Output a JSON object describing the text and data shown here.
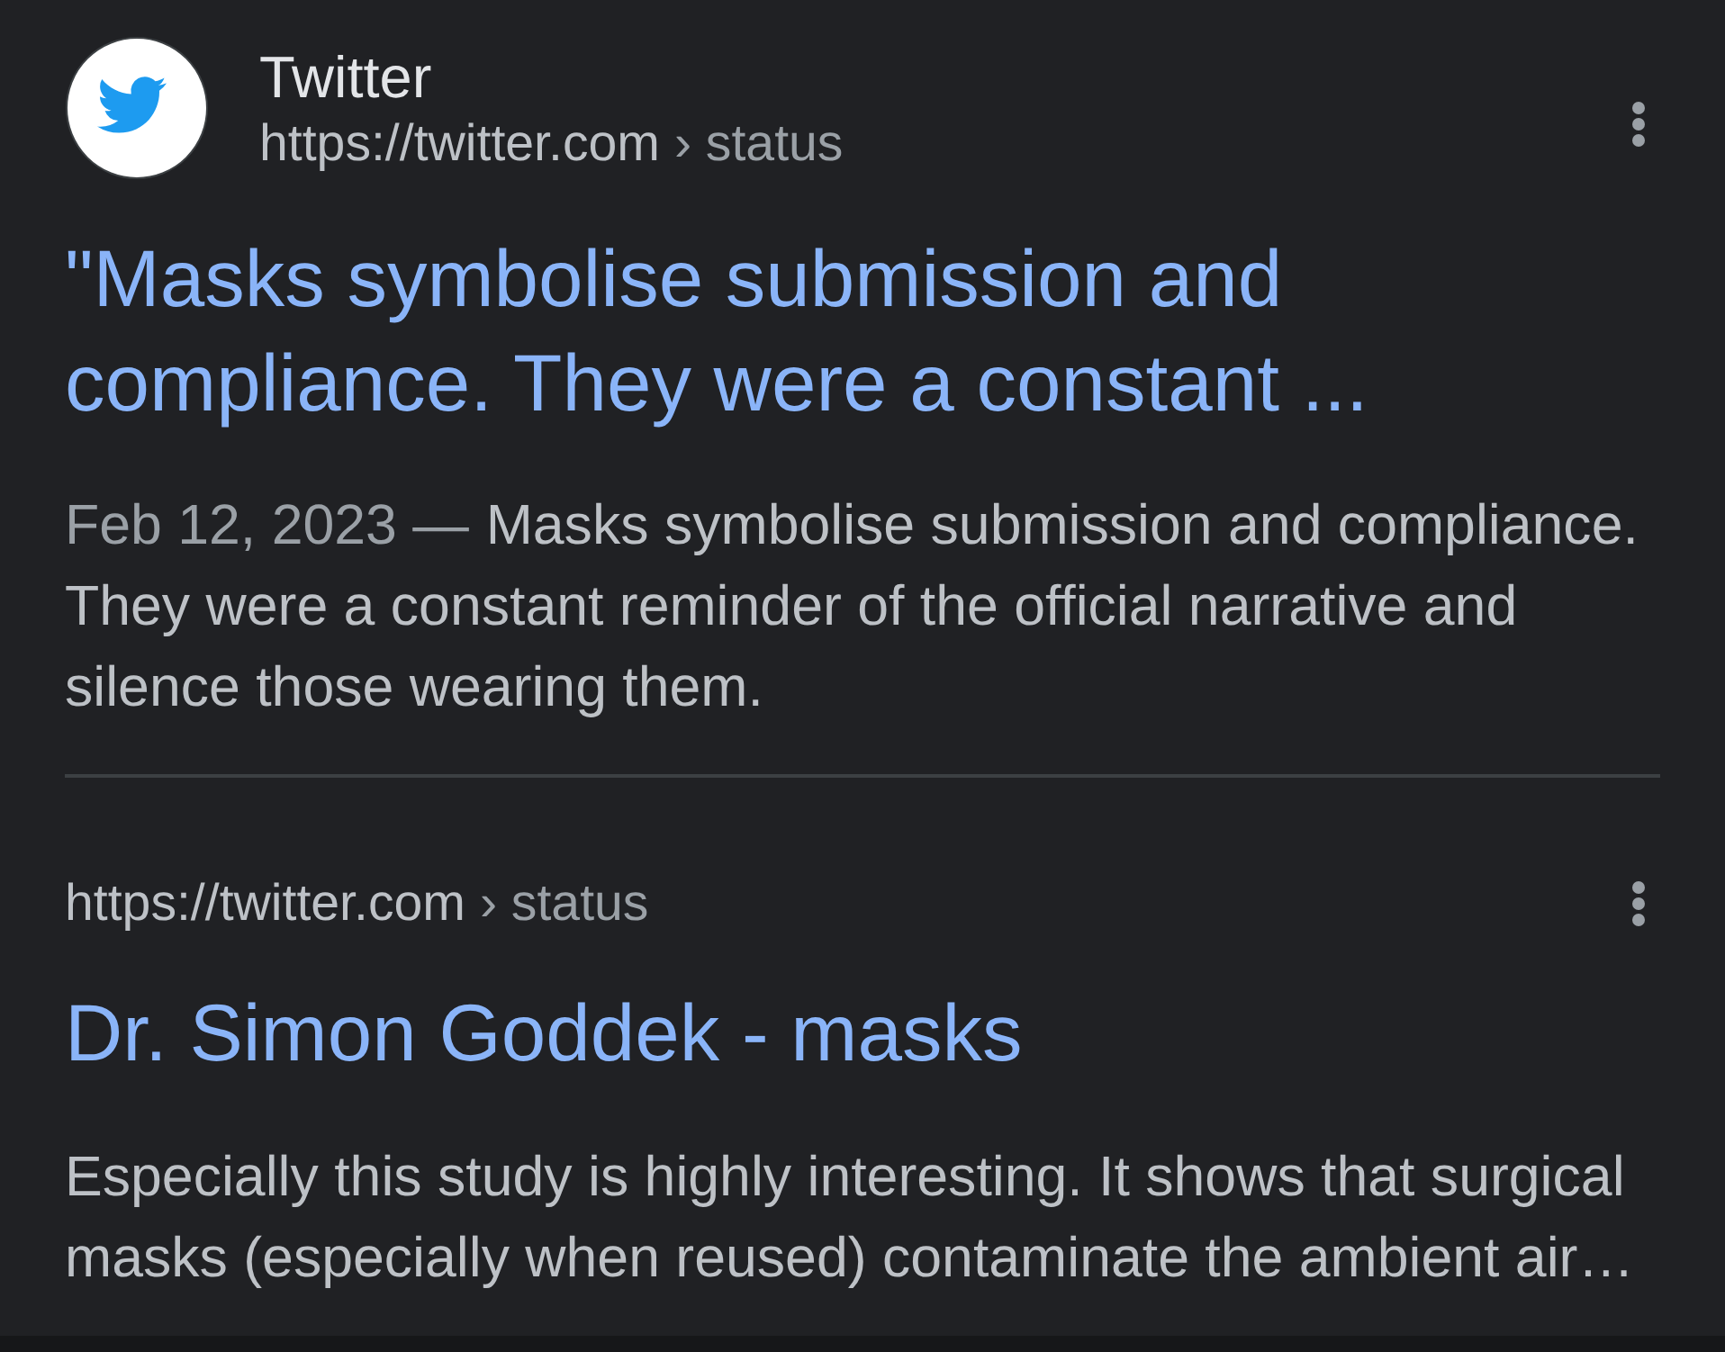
{
  "results": [
    {
      "kind": "with_source",
      "site_name": "Twitter",
      "url": "https://twitter.com",
      "path": "› status",
      "title": "\"Masks symbolise submission and compliance. They were a constant ...",
      "date": "Feb 12, 2023 —",
      "snippet": "Masks symbolise submission and compliance. They were a constant reminder of the official narrative and silence those wearing them."
    },
    {
      "kind": "url_only",
      "url": "https://twitter.com",
      "path": "› status",
      "title": "Dr. Simon Goddek - masks",
      "snippet": "Especially this study is highly interesting. It shows that surgical masks (especially when reused) contaminate the ambient air…"
    }
  ]
}
